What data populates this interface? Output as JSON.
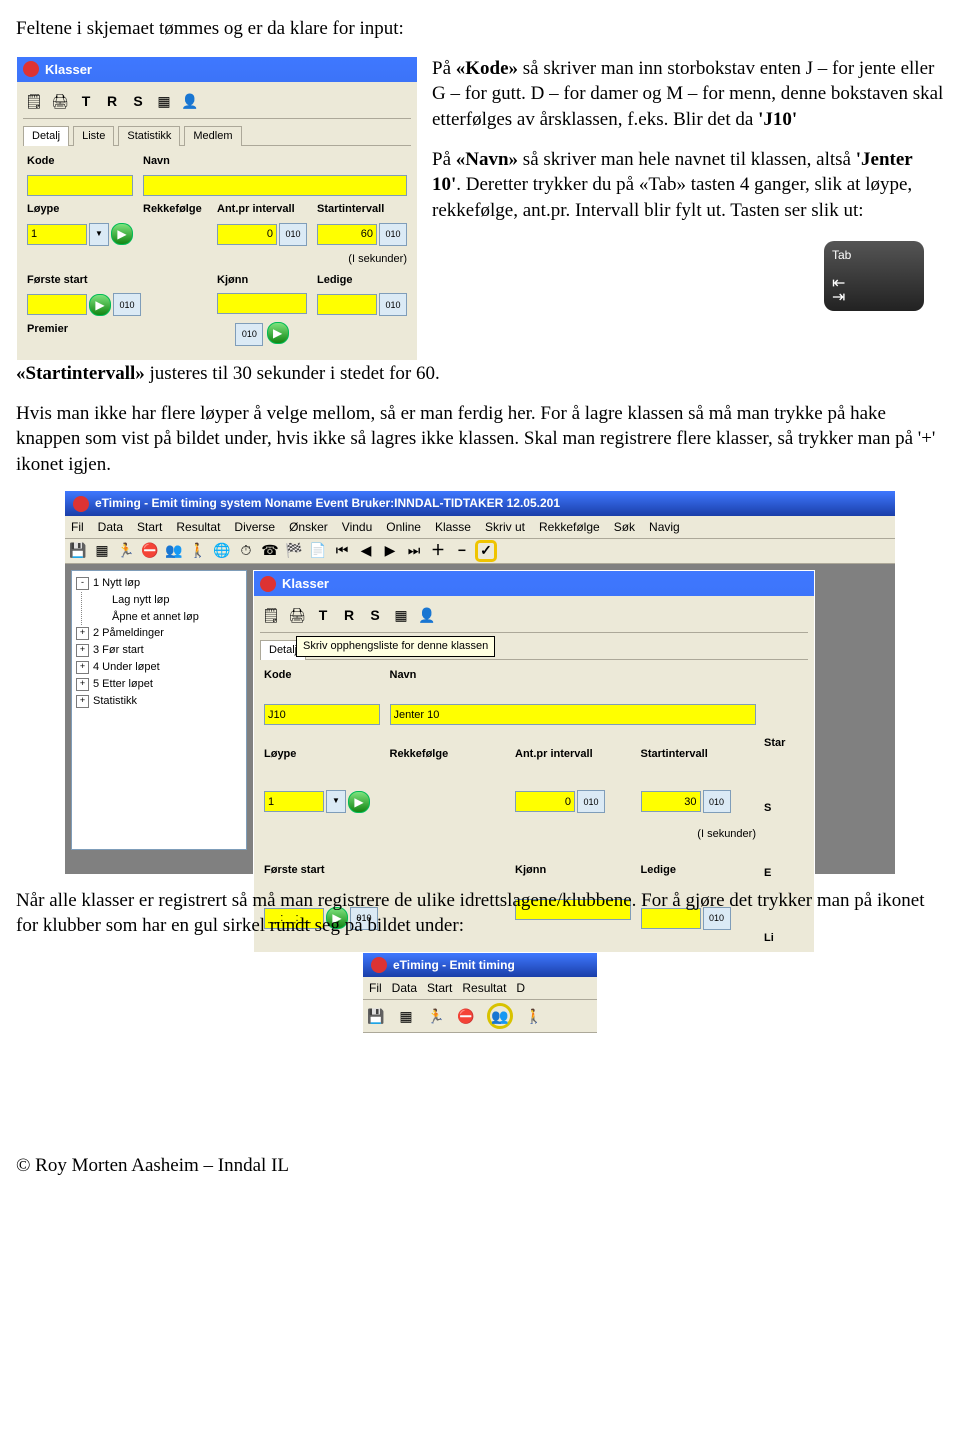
{
  "intro": "Feltene i skjemaet tømmes og er da klare for input:",
  "panel": {
    "title": "Klasser",
    "tb_labels": [
      "T",
      "R",
      "S"
    ],
    "tabs": [
      "Detalj",
      "Liste",
      "Statistikk",
      "Medlem"
    ],
    "labels": {
      "kode": "Kode",
      "navn": "Navn",
      "loype": "Løype",
      "rekkefolge": "Rekkefølge",
      "antpr": "Ant.pr intervall",
      "startintervall": "Startintervall",
      "sekunder": "(I sekunder)",
      "forste": "Første start",
      "kjonn": "Kjønn",
      "ledige": "Ledige",
      "premier": "Premier"
    },
    "values": {
      "loype": "1",
      "antpr": "0",
      "startintervall": "60",
      "chip": "010"
    }
  },
  "text_right": {
    "p1a": "På ",
    "p1b": "«Kode»",
    "p1c": " så skriver man inn storbokstav enten J – for jente eller G – for gutt. D – for damer og M – for menn, denne bokstaven skal etterfølges av årsklassen, f.eks. Blir det da ",
    "p1d": "'J10'",
    "p2a": "På ",
    "p2b": "«Navn»",
    "p2c": " så skriver man hele navnet til klassen, altså ",
    "p2d": "'Jenter 10'",
    "p2e": ". Deretter trykker du på «Tab» tasten 4 ganger, slik at løype, rekkefølge, ant.pr. Intervall blir fylt ut. Tasten ser slik ut:"
  },
  "tab_key_label": "Tab",
  "mid": {
    "p1a": "«Startintervall» ",
    "p1b": "justeres til 30 sekunder i stedet for 60.",
    "p2": "Hvis man ikke har flere løyper å velge mellom, så er man ferdig her. For å lagre klassen så må man trykke på hake knappen som vist på bildet under, hvis ikke så lagres ikke klassen. Skal man registrere flere klasser, så trykker man på '+' ikonet igjen."
  },
  "et": {
    "title": "eTiming - Emit timing system   Noname Event   Bruker:INNDAL-TIDTAKER   12.05.201",
    "menu": [
      "Fil",
      "Data",
      "Start",
      "Resultat",
      "Diverse",
      "Ønsker",
      "Vindu",
      "Online",
      "Klasse",
      "Skriv ut",
      "Rekkefølge",
      "Søk",
      "Navig"
    ],
    "tooltip": "Skriv opphengsliste for denne klassen",
    "tree": {
      "n1": "1 Nytt løp",
      "n1a": "Lag nytt løp",
      "n1b": "Åpne et annet løp",
      "n2": "2 Påmeldinger",
      "n3": "3 Før start",
      "n4": "4 Under løpet",
      "n5": "5 Etter løpet",
      "n6": "Statistikk"
    },
    "panel2": {
      "kode": "J10",
      "navn": "Jenter 10",
      "loype": "1",
      "antpr": "0",
      "startintervall": "30",
      "forste": "__:__:__",
      "right": {
        "star": "Star",
        "s": "S",
        "e": "E",
        "li": "Li"
      }
    }
  },
  "after1": "Når alle klasser er registrert så må man registrere de ulike idrettslagene/klubbene. For å gjøre det trykker man på ikonet for klubber som har en gul sirkel rundt seg på bildet under:",
  "et_small": {
    "title": "eTiming - Emit timing",
    "menu": [
      "Fil",
      "Data",
      "Start",
      "Resultat",
      "D"
    ]
  },
  "footer": "© Roy Morten Aasheim – Inndal IL"
}
